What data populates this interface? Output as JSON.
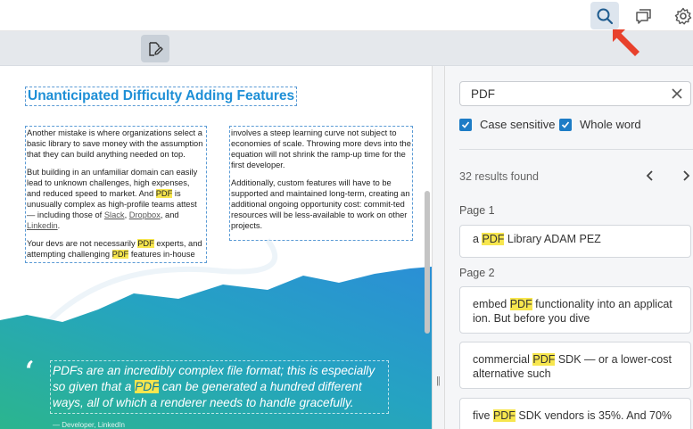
{
  "topbar": {
    "icons": [
      "search-icon",
      "comments-icon",
      "gear-icon"
    ]
  },
  "toolbar": {
    "icons": [
      "edit-annotation-icon"
    ]
  },
  "document": {
    "heading": "Unanticipated Difficulty Adding Features",
    "col1": {
      "p1": "Another mistake is where organizations select a basic library to save money with the assumption that they can build anything needed on top.",
      "p2_a": "But building in an unfamiliar domain can easily lead to unknown challenges, high expenses, and reduced speed to market. And ",
      "p2_hl": "PDF",
      "p2_b": " is unusually complex as high-profile teams attest — including those of ",
      "p2_link1": "Slack",
      "p2_sep1": ", ",
      "p2_link2": "Dropbox",
      "p2_sep2": ", and ",
      "p2_link3": "Linkedin",
      "p2_end": ".",
      "p3_a": "Your devs are not necessarily ",
      "p3_hl1": "PDF",
      "p3_b": " experts, and attempting challenging ",
      "p3_hl2": "PDF",
      "p3_c": " features in-house"
    },
    "col2": {
      "p1": "involves a steep learning curve not subject to economies of scale. Throwing more devs into the equation will not shrink the ramp-up time for the first developer.",
      "p2": "Additionally, custom features will have to be supported and maintained long-term, creating an additional ongoing opportunity cost: commit-ted resources will be less-available to work on other projects."
    },
    "quote": {
      "mark": "‘",
      "text_a": "PDFs are an incredibly complex file format; this is especially so given that a ",
      "text_hl": "PDF",
      "text_b": " can be generated a hundred different ways, all of which a renderer needs to handle gracefully.",
      "author": "— Developer, LinkedIn"
    }
  },
  "search": {
    "query": "PDF",
    "case_sensitive_label": "Case sensitive",
    "case_sensitive_checked": true,
    "whole_word_label": "Whole word",
    "whole_word_checked": true,
    "results_count": "32 results found",
    "page1_label": "Page 1",
    "page2_label": "Page 2",
    "results": [
      {
        "pre": "a ",
        "match": "PDF",
        "post": " Library ADAM PEZ"
      },
      {
        "pre": "embed ",
        "match": "PDF",
        "post": " functionality into an applicat ion. But before you dive"
      },
      {
        "pre": "commercial ",
        "match": "PDF",
        "post": " SDK — or a lower-cost alternative such"
      },
      {
        "pre": "five ",
        "match": "PDF",
        "post": " SDK vendors is 35%. And 70%"
      }
    ]
  },
  "colors": {
    "accent": "#1d7cc6",
    "highlight": "#f7e64e",
    "heading": "#1e8fd6",
    "cursor": "#e8412c"
  }
}
